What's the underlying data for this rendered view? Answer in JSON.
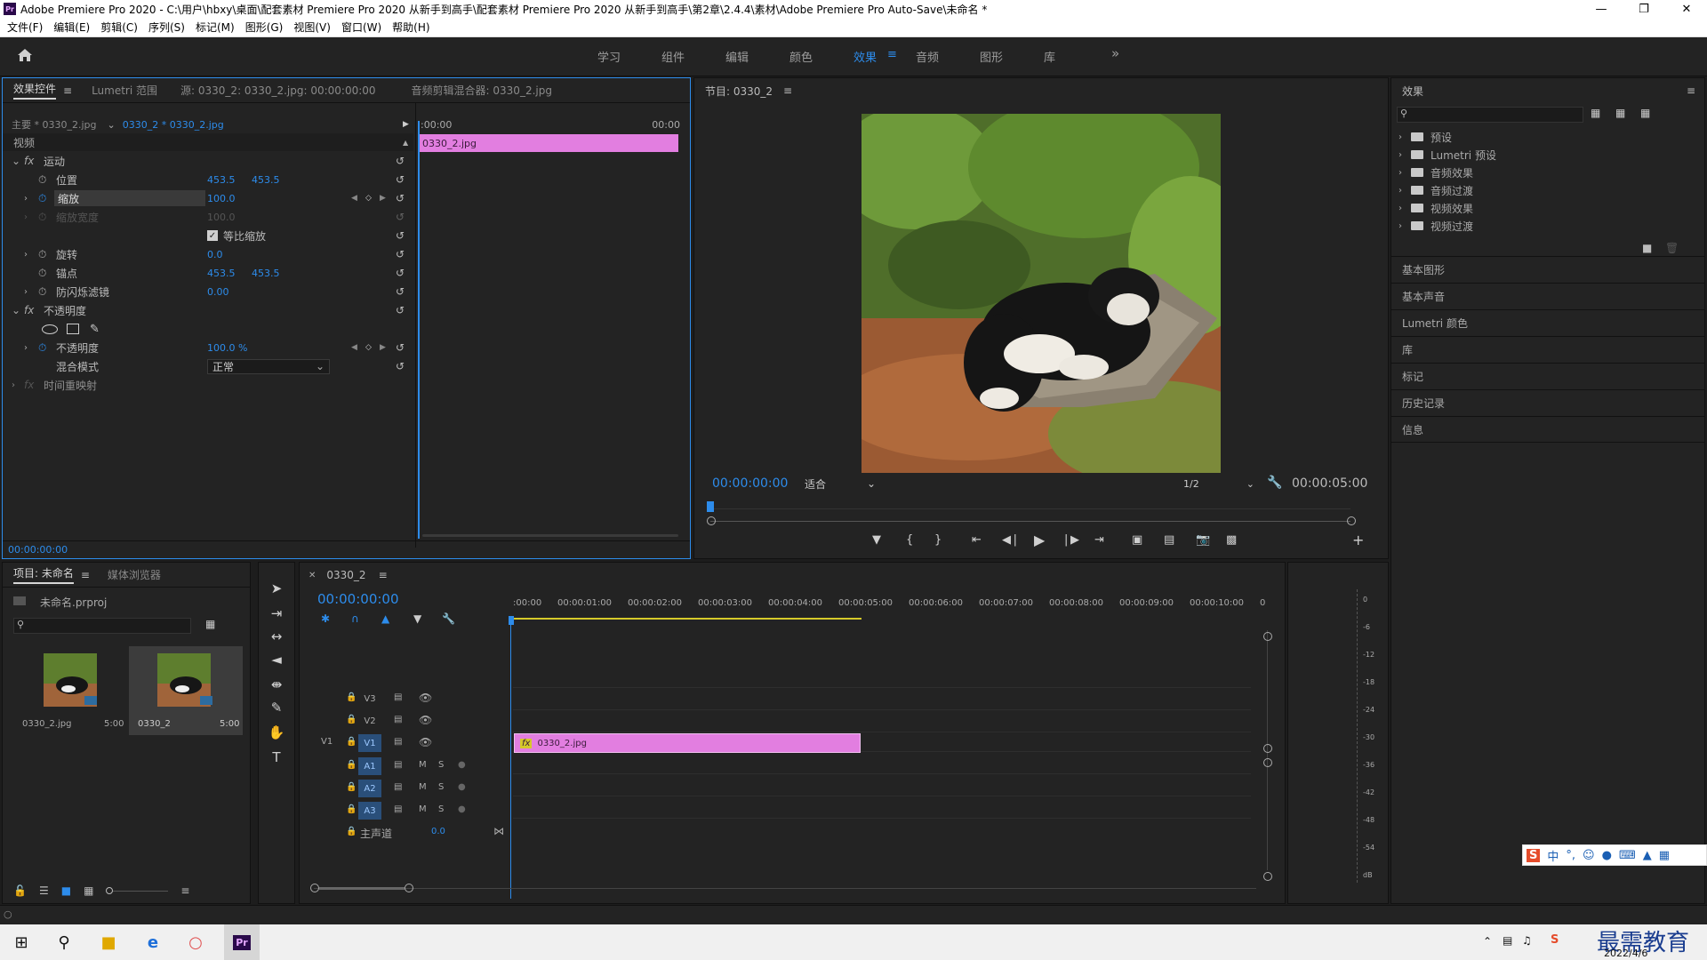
{
  "window": {
    "title": "Adobe Premiere Pro 2020 - C:\\用户\\hbxy\\桌面\\配套素材 Premiere Pro 2020 从新手到高手\\配套素材 Premiere Pro 2020 从新手到高手\\第2章\\2.4.4\\素材\\Adobe Premiere Pro Auto-Save\\未命名 *",
    "app_badge": "Pr"
  },
  "menu": [
    "文件(F)",
    "编辑(E)",
    "剪辑(C)",
    "序列(S)",
    "标记(M)",
    "图形(G)",
    "视图(V)",
    "窗口(W)",
    "帮助(H)"
  ],
  "workspaces": {
    "items": [
      "学习",
      "组件",
      "编辑",
      "颜色",
      "效果",
      "音频",
      "图形",
      "库"
    ],
    "active": "效果",
    "overflow": "»"
  },
  "effect_controls": {
    "tabs": [
      "效果控件",
      "Lumetri 范围",
      "源: 0330_2: 0330_2.jpg: 00:00:00:00",
      "音频剪辑混合器: 0330_2.jpg"
    ],
    "master_label": "主要 * 0330_2.jpg",
    "sequence_label": "0330_2 * 0330_2.jpg",
    "section_video": "视频",
    "fx_motion": "运动",
    "position_label": "位置",
    "position_x": "453.5",
    "position_y": "453.5",
    "scale_label": "缩放",
    "scale_value": "100.0",
    "scale_width_label": "缩放宽度",
    "scale_width_value": "100.0",
    "uniform_scale_label": "等比缩放",
    "rotation_label": "旋转",
    "rotation_value": "0.0",
    "anchor_label": "锚点",
    "anchor_x": "453.5",
    "anchor_y": "453.5",
    "flicker_label": "防闪烁滤镜",
    "flicker_value": "0.00",
    "fx_opacity": "不透明度",
    "opacity_label": "不透明度",
    "opacity_value": "100.0 %",
    "blend_label": "混合模式",
    "blend_value": "正常",
    "fx_time": "时间重映射",
    "ruler_start": ":00:00",
    "ruler_end": "00:00",
    "clip_name": "0330_2.jpg",
    "timecode": "00:00:00:00"
  },
  "program": {
    "title": "节目: 0330_2",
    "timecode": "00:00:00:00",
    "fit": "适合",
    "resolution": "1/2",
    "duration": "00:00:05:00"
  },
  "effects_panel": {
    "title": "效果",
    "folders": [
      "预设",
      "Lumetri 预设",
      "音频效果",
      "音频过渡",
      "视频效果",
      "视频过渡"
    ],
    "side_panels": [
      "基本图形",
      "基本声音",
      "Lumetri 颜色",
      "库",
      "标记",
      "历史记录",
      "信息"
    ]
  },
  "project": {
    "tabs": [
      "项目: 未命名",
      "媒体浏览器"
    ],
    "file": "未命名.prproj",
    "items": [
      {
        "name": "0330_2.jpg",
        "duration": "5:00"
      },
      {
        "name": "0330_2",
        "duration": "5:00"
      }
    ]
  },
  "timeline": {
    "sequence": "0330_2",
    "timecode": "00:00:00:00",
    "ruler": [
      ":00:00",
      "00:00:01:00",
      "00:00:02:00",
      "00:00:03:00",
      "00:00:04:00",
      "00:00:05:00",
      "00:00:06:00",
      "00:00:07:00",
      "00:00:08:00",
      "00:00:09:00",
      "00:00:10:00",
      "0"
    ],
    "video_tracks": [
      "V3",
      "V2",
      "V1"
    ],
    "audio_tracks": [
      "A1",
      "A2",
      "A3"
    ],
    "source_patch": "V1",
    "mute": "M",
    "solo": "S",
    "master_label": "主声道",
    "master_value": "0.0",
    "clip_name": "0330_2.jpg",
    "clip_fx": "fx"
  },
  "meter": {
    "ticks": [
      "0",
      "-6",
      "-12",
      "-18",
      "-24",
      "-30",
      "-36",
      "-42",
      "-48",
      "-54",
      "dB"
    ]
  },
  "watermark": "最需教育",
  "taskbar": {
    "date": "2022/4/6"
  },
  "ime": [
    "中",
    "°,"
  ],
  "colors": {
    "accent": "#2d8ceb",
    "clip": "#e27ee0",
    "panel": "#232323"
  }
}
